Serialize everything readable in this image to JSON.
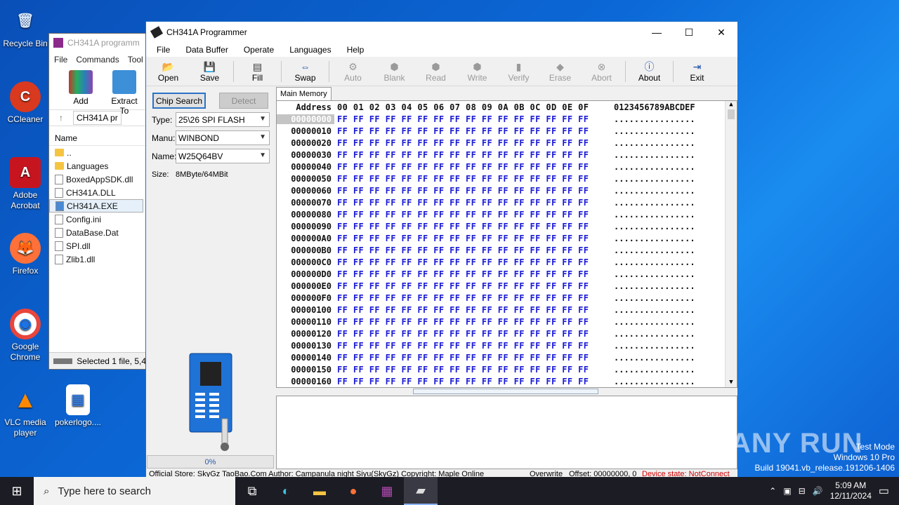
{
  "desktop": {
    "icons": [
      {
        "label": "Recycle Bin",
        "glyph": "🗑"
      },
      {
        "label": "CCleaner",
        "glyph": "C"
      },
      {
        "label": "Adobe Acrobat",
        "glyph": "A"
      },
      {
        "label": "Firefox",
        "glyph": "🦊"
      },
      {
        "label": "Google Chrome",
        "glyph": "◉"
      },
      {
        "label": "VLC media player",
        "glyph": "▲"
      },
      {
        "label": "pokerlogo....",
        "glyph": "▦"
      }
    ]
  },
  "winrar": {
    "title": "CH341A programm",
    "menu": [
      "File",
      "Commands",
      "Tool"
    ],
    "toolbar": [
      "Add",
      "Extract To"
    ],
    "path": "CH341A pr",
    "column": "Name",
    "files": [
      "..",
      "Languages",
      "BoxedAppSDK.dll",
      "CH341A.DLL",
      "CH341A.EXE",
      "Config.ini",
      "DataBase.Dat",
      "SPI.dll",
      "Zlib1.dll"
    ],
    "status": "Selected 1 file, 5,4"
  },
  "app": {
    "title": "CH341A Programmer",
    "menu": [
      "File",
      "Data Buffer",
      "Operate",
      "Languages",
      "Help"
    ],
    "toolbar": {
      "open": "Open",
      "save": "Save",
      "fill": "Fill",
      "swap": "Swap",
      "auto": "Auto",
      "blank": "Blank",
      "read": "Read",
      "write": "Write",
      "verify": "Verify",
      "erase": "Erase",
      "abort": "Abort",
      "about": "About",
      "exit": "Exit"
    },
    "chip_search": "Chip Search",
    "detect": "Detect",
    "type_label": "Type:",
    "type_value": "25\\26 SPI FLASH",
    "manu_label": "Manu:",
    "manu_value": "WINBOND",
    "name_label": "Name:",
    "name_value": "W25Q64BV",
    "size_label": "Size:",
    "size_value": "8MByte/64MBit",
    "progress_text": "0%",
    "progress": 0,
    "tab": "Main Memory",
    "hex_header": {
      "address": "Address",
      "columns": "00 01 02 03 04 05 06 07 08 09 0A 0B 0C 0D 0E 0F",
      "ascii": "0123456789ABCDEF"
    },
    "hex_rows": [
      {
        "addr": "00000000",
        "bytes": "FF FF FF FF FF FF FF FF FF FF FF FF FF FF FF FF",
        "ascii": "................"
      },
      {
        "addr": "00000010",
        "bytes": "FF FF FF FF FF FF FF FF FF FF FF FF FF FF FF FF",
        "ascii": "................"
      },
      {
        "addr": "00000020",
        "bytes": "FF FF FF FF FF FF FF FF FF FF FF FF FF FF FF FF",
        "ascii": "................"
      },
      {
        "addr": "00000030",
        "bytes": "FF FF FF FF FF FF FF FF FF FF FF FF FF FF FF FF",
        "ascii": "................"
      },
      {
        "addr": "00000040",
        "bytes": "FF FF FF FF FF FF FF FF FF FF FF FF FF FF FF FF",
        "ascii": "................"
      },
      {
        "addr": "00000050",
        "bytes": "FF FF FF FF FF FF FF FF FF FF FF FF FF FF FF FF",
        "ascii": "................"
      },
      {
        "addr": "00000060",
        "bytes": "FF FF FF FF FF FF FF FF FF FF FF FF FF FF FF FF",
        "ascii": "................"
      },
      {
        "addr": "00000070",
        "bytes": "FF FF FF FF FF FF FF FF FF FF FF FF FF FF FF FF",
        "ascii": "................"
      },
      {
        "addr": "00000080",
        "bytes": "FF FF FF FF FF FF FF FF FF FF FF FF FF FF FF FF",
        "ascii": "................"
      },
      {
        "addr": "00000090",
        "bytes": "FF FF FF FF FF FF FF FF FF FF FF FF FF FF FF FF",
        "ascii": "................"
      },
      {
        "addr": "000000A0",
        "bytes": "FF FF FF FF FF FF FF FF FF FF FF FF FF FF FF FF",
        "ascii": "................"
      },
      {
        "addr": "000000B0",
        "bytes": "FF FF FF FF FF FF FF FF FF FF FF FF FF FF FF FF",
        "ascii": "................"
      },
      {
        "addr": "000000C0",
        "bytes": "FF FF FF FF FF FF FF FF FF FF FF FF FF FF FF FF",
        "ascii": "................"
      },
      {
        "addr": "000000D0",
        "bytes": "FF FF FF FF FF FF FF FF FF FF FF FF FF FF FF FF",
        "ascii": "................"
      },
      {
        "addr": "000000E0",
        "bytes": "FF FF FF FF FF FF FF FF FF FF FF FF FF FF FF FF",
        "ascii": "................"
      },
      {
        "addr": "000000F0",
        "bytes": "FF FF FF FF FF FF FF FF FF FF FF FF FF FF FF FF",
        "ascii": "................"
      },
      {
        "addr": "00000100",
        "bytes": "FF FF FF FF FF FF FF FF FF FF FF FF FF FF FF FF",
        "ascii": "................"
      },
      {
        "addr": "00000110",
        "bytes": "FF FF FF FF FF FF FF FF FF FF FF FF FF FF FF FF",
        "ascii": "................"
      },
      {
        "addr": "00000120",
        "bytes": "FF FF FF FF FF FF FF FF FF FF FF FF FF FF FF FF",
        "ascii": "................"
      },
      {
        "addr": "00000130",
        "bytes": "FF FF FF FF FF FF FF FF FF FF FF FF FF FF FF FF",
        "ascii": "................"
      },
      {
        "addr": "00000140",
        "bytes": "FF FF FF FF FF FF FF FF FF FF FF FF FF FF FF FF",
        "ascii": "................"
      },
      {
        "addr": "00000150",
        "bytes": "FF FF FF FF FF FF FF FF FF FF FF FF FF FF FF FF",
        "ascii": "................"
      },
      {
        "addr": "00000160",
        "bytes": "FF FF FF FF FF FF FF FF FF FF FF FF FF FF FF FF",
        "ascii": "................"
      }
    ],
    "status": {
      "store": "Official Store: SkyGz TaoBao.Com Author: Campanula night Siyu(SkyGz) Copyright: Maple Online",
      "mode": "Overwrite",
      "offset": "Offset: 00000000, 0",
      "device": "Device state: NotConnect",
      "device_color": "#d40000"
    }
  },
  "taskbar": {
    "search_placeholder": "Type here to search",
    "time": "5:09 AM",
    "date": "12/11/2024"
  },
  "watermark": {
    "line1": "Test Mode",
    "line2": "Windows 10 Pro",
    "line3": "Build 19041.vb_release.191206-1406",
    "brand": "ANY RUN"
  }
}
